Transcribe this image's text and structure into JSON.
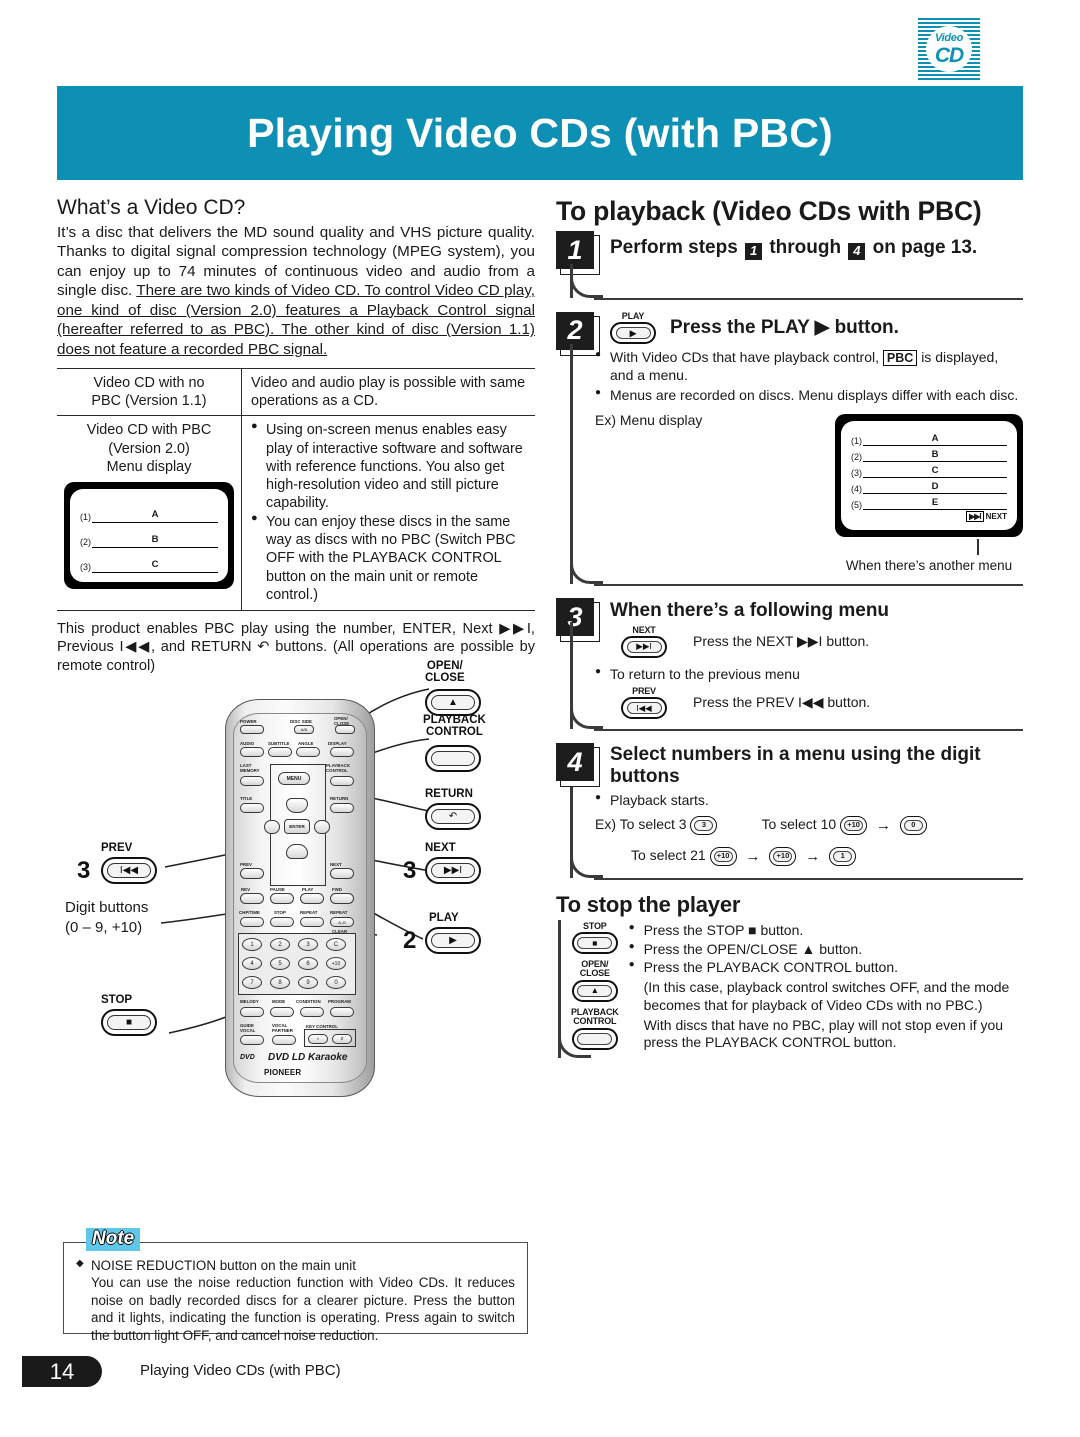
{
  "logo": {
    "line1": "Video",
    "line2": "CD",
    "name": "video-cd-logo"
  },
  "banner": {
    "title": "Playing Video CDs (with PBC)",
    "color": "#0e90b5"
  },
  "left": {
    "heading": "What’s a Video CD?",
    "intro_plain": "It’s a disc that delivers the MD sound quality and VHS picture quality. Thanks to digital signal compression technology (MPEG system), you can enjoy up to 74 minutes of continuous video and audio from a single disc. ",
    "intro_underlined": "There are two kinds of Video CD. To control Video CD play, one kind of disc (Version 2.0) features a Playback Control signal (hereafter referred to as PBC). The other kind of disc (Version 1.1) does not feature a recorded PBC signal.",
    "table": {
      "row1": {
        "label_line1": "Video CD with no",
        "label_line2": "PBC (Version 1.1)",
        "desc": "Video and audio play is possible with same operations as a CD."
      },
      "row2": {
        "label_line1": "Video CD with PBC",
        "label_line2": "(Version 2.0)",
        "label_line3": "Menu display",
        "bullets": [
          "Using on-screen menus enables easy play of interactive software and software with reference functions. You also get high-resolution video and still picture capability.",
          "You can enjoy these discs in the same way as discs with no PBC (Switch PBC OFF with the PLAYBACK CONTROL button on the main unit or remote control.)"
        ],
        "menu_rows": [
          {
            "num": "(1)",
            "label": "A"
          },
          {
            "num": "(2)",
            "label": "B"
          },
          {
            "num": "(3)",
            "label": "C"
          }
        ]
      }
    },
    "remote_intro": "This product enables PBC play using the number, ENTER, Next ▶▶I, Previous I◀◀, and RETURN ↶ buttons. (All operations are possible by remote control)",
    "callouts": {
      "open_close": {
        "line1": "OPEN/",
        "line2": "CLOSE",
        "glyph": "▲"
      },
      "playback_control": {
        "line1": "PLAYBACK",
        "line2": "CONTROL",
        "glyph": ""
      },
      "return": {
        "line1": "RETURN",
        "glyph": "↶"
      },
      "next": {
        "line1": "NEXT",
        "glyph": "▶▶I",
        "step": "3"
      },
      "prev": {
        "line1": "PREV",
        "glyph": "I◀◀",
        "step": "3"
      },
      "play": {
        "line1": "PLAY",
        "glyph": "▶",
        "step": "2"
      },
      "stop": {
        "line1": "STOP",
        "glyph": "■"
      },
      "digit": {
        "line1": "Digit buttons",
        "line2": "(0 – 9, +10)"
      }
    },
    "remote_labels": {
      "power": "POWER",
      "disc_side": "DISC SIDE",
      "disc_side_btn": "A/B",
      "open_close": "OPEN/ CLOSE",
      "audio": "AUDIO",
      "subtitle": "SUBTITLE",
      "angle": "ANGLE",
      "display": "DISPLAY",
      "last_memory": "LAST MEMORY",
      "menu": "MENU",
      "playback_control": "PLAYBACK CONTROL",
      "title": "TITLE",
      "return": "RETURN",
      "enter": "ENTER",
      "prev": "PREV",
      "next": "NEXT",
      "rev": "REV",
      "pause": "PAUSE",
      "play": "PLAY",
      "fwd": "FWD",
      "chp_time": "CHP/TIME",
      "stop": "STOP",
      "repeat": "REPEAT",
      "repeat_ab": "REPEAT",
      "repeat_ab_btn": "A–B",
      "clear": "CLEAR",
      "melody": "MELODY",
      "mode": "MODE",
      "condition": "CONDITION",
      "program": "PROGRAM",
      "guide_vocal": "GUIDE VOCAL",
      "vocal_partner": "VOCAL PARTNER",
      "key_control": "KEY CONTROL",
      "key_flat": "♭",
      "key_sharp": "♯",
      "digits": [
        "1",
        "2",
        "3",
        "C",
        "4",
        "5",
        "6",
        "+10",
        "7",
        "8",
        "9",
        "0"
      ],
      "brand_dvd": "DVD",
      "brand_name": "DVD LD Karaoke",
      "brand_pioneer": "PIONEER"
    },
    "note": {
      "tag": "Note",
      "lead": "NOISE REDUCTION button on the main unit",
      "body": "You can use the noise reduction function with Video CDs. It reduces noise on badly recorded discs for a clearer picture. Press the button and it lights, indicating the function is operating. Press again to switch the button light OFF, and cancel noise reduction."
    }
  },
  "right": {
    "heading": "To playback (Video CDs with PBC)",
    "step1": {
      "badge": "1",
      "text_a": "Perform steps",
      "inline_a": "1",
      "text_b": "through",
      "inline_b": "4",
      "text_c": "on page 13."
    },
    "step2": {
      "badge": "2",
      "button_cap": "PLAY",
      "button_glyph": "▶",
      "heading": "Press the PLAY ▶ button.",
      "bullet1_a": "With Video CDs that have playback control,",
      "bullet1_badge": "PBC",
      "bullet1_b": "is displayed, and a menu.",
      "bullet2": "Menus are recorded on discs. Menu displays differ with each disc.",
      "ex_label": "Ex) Menu display",
      "menu_rows": [
        {
          "num": "(1)",
          "label": "A"
        },
        {
          "num": "(2)",
          "label": "B"
        },
        {
          "num": "(3)",
          "label": "C"
        },
        {
          "num": "(4)",
          "label": "D"
        },
        {
          "num": "(5)",
          "label": "E"
        }
      ],
      "menu_next_glyph": "▶▶I",
      "menu_next_label": "NEXT",
      "caption": "When there’s another menu"
    },
    "step3": {
      "badge": "3",
      "heading": "When there’s a following menu",
      "next_cap": "NEXT",
      "next_glyph": "▶▶I",
      "next_text": "Press the NEXT ▶▶I button.",
      "bullet": "To return to the previous menu",
      "prev_cap": "PREV",
      "prev_glyph": "I◀◀",
      "prev_text": "Press the PREV I◀◀ button."
    },
    "step4": {
      "badge": "4",
      "heading_line1": "Select numbers in a menu using the digit",
      "heading_line2": "buttons",
      "bullet": "Playback starts.",
      "ex3_label": "Ex) To select 3",
      "ex3_keys": [
        "3"
      ],
      "ex10_label": "To select 10",
      "ex10_keys": [
        "+10",
        "0"
      ],
      "ex21_label": "To select 21",
      "ex21_keys": [
        "+10",
        "+10",
        "1"
      ],
      "arrow": "→"
    },
    "stop_section": {
      "heading": "To stop the player",
      "buttons": [
        {
          "cap1": "STOP",
          "cap2": "",
          "glyph": "■"
        },
        {
          "cap1": "OPEN/",
          "cap2": "CLOSE",
          "glyph": "▲"
        },
        {
          "cap1": "PLAYBACK",
          "cap2": "CONTROL",
          "glyph": ""
        }
      ],
      "bullets": [
        "Press the STOP ■ button.",
        "Press the OPEN/CLOSE ▲ button.",
        "Press the PLAYBACK CONTROL button."
      ],
      "cont1": "(In this case, playback control switches OFF, and the mode becomes that for playback of Video CDs with no PBC.)",
      "cont2": "With discs that have no PBC, play will not stop even if you press the PLAYBACK CONTROL button."
    }
  },
  "footer": {
    "page": "14",
    "title": "Playing Video CDs (with PBC)"
  }
}
